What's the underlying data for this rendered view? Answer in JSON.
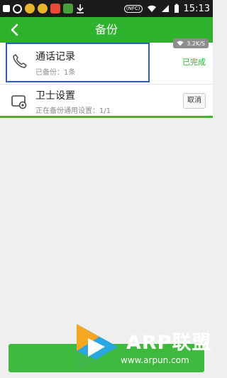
{
  "status_bar": {
    "nfc_label": "(NFC)",
    "time": "15:13"
  },
  "app_bar": {
    "title": "备份"
  },
  "speed": {
    "value": "3.2K/S"
  },
  "items": [
    {
      "title": "通话记录",
      "subtitle": "已备份：1条",
      "status": "已完成",
      "icon": "phone-icon"
    },
    {
      "title": "卫士设置",
      "subtitle": "正在备份通用设置：1/1",
      "action": "取消",
      "icon": "settings-icon",
      "progress": 1.0
    }
  ],
  "watermark": {
    "brand": "ARP联盟",
    "url": "www.arpun.com"
  },
  "colors": {
    "accent": "#2fb32f",
    "highlight": "#2e5fb8",
    "status_bar": "#1b1b1b"
  }
}
